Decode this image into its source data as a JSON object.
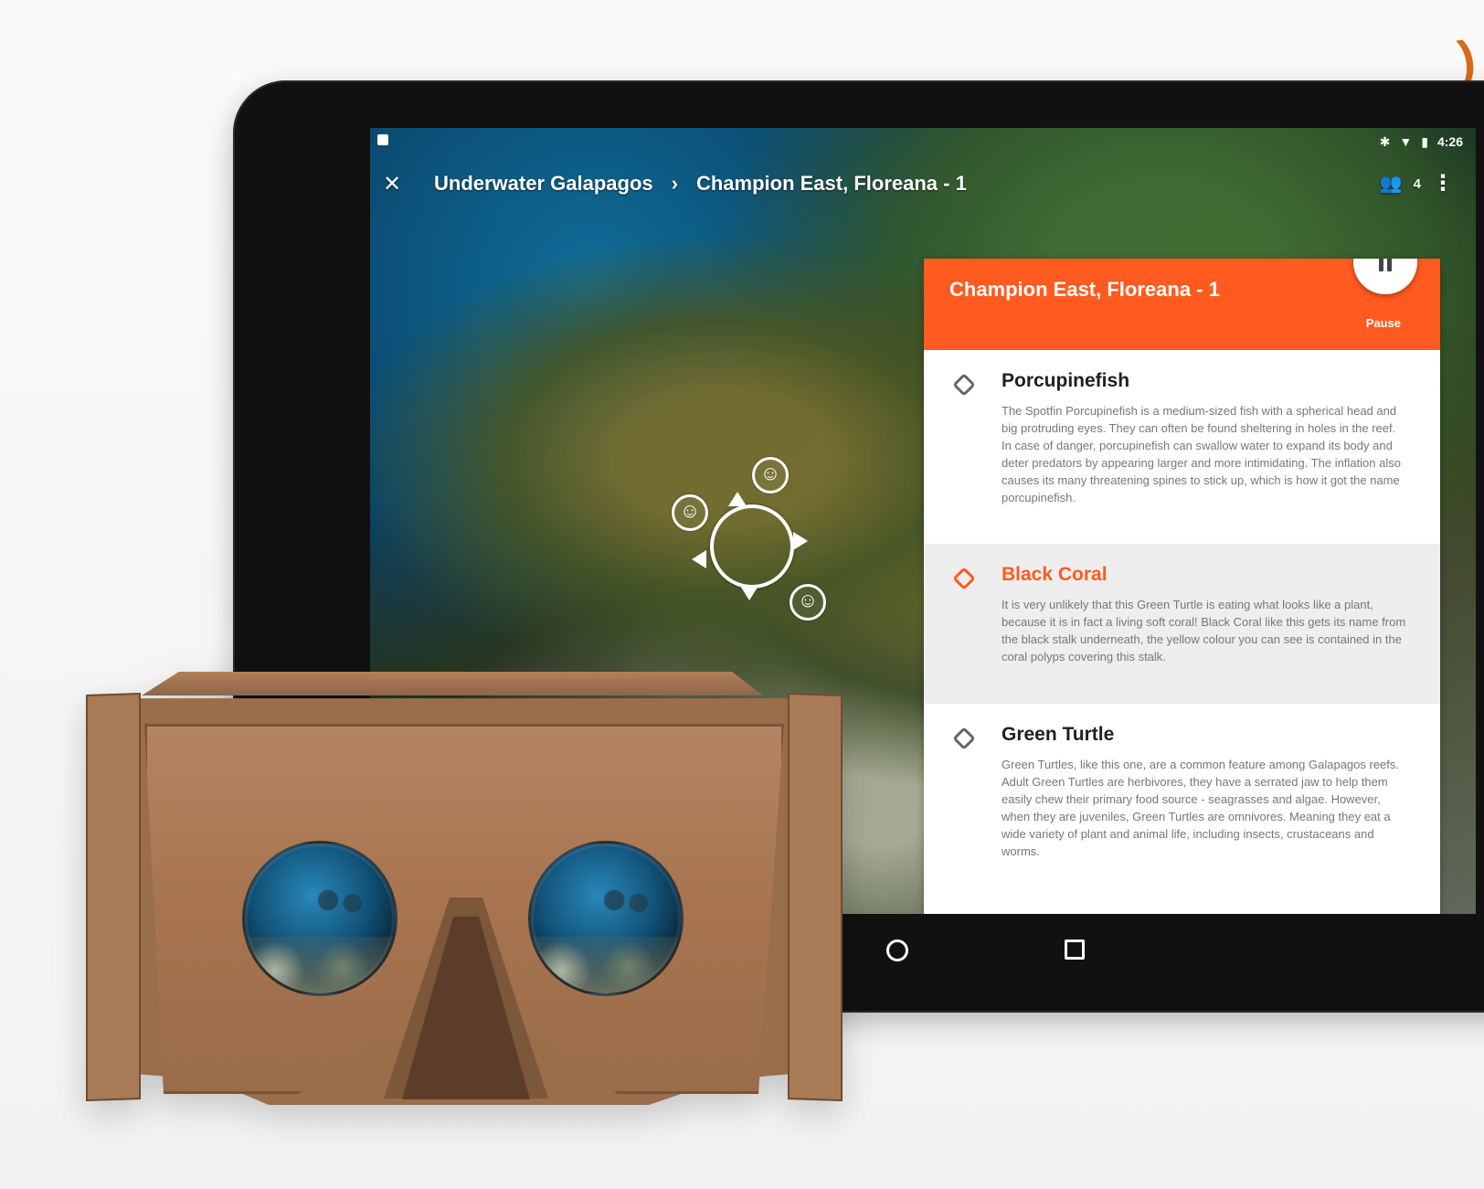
{
  "status_bar": {
    "time": "4:26",
    "icons": [
      "bluetooth-icon",
      "wifi-icon",
      "battery-icon"
    ]
  },
  "app_bar": {
    "close_icon": "close-icon",
    "breadcrumb": {
      "level1": "Underwater Galapagos",
      "separator": "›",
      "level2": "Champion East, Floreana - 1"
    },
    "participants_count": "4",
    "participants_icon": "people-icon",
    "more_icon": "more-vertical-icon"
  },
  "panel": {
    "title": "Champion East, Floreana - 1",
    "pause_label": "Pause",
    "items": [
      {
        "title": "Porcupinefish",
        "text": "The Spotfin Porcupinefish is a medium-sized fish with a spherical head and big protruding eyes. They can often be found sheltering in holes in the reef. In case of danger, porcupinefish can swallow water to expand its body and deter predators by appearing larger and more intimidating. The inflation also causes its many threatening spines to stick up, which is how it got the name porcupinefish."
      },
      {
        "title": "Black Coral",
        "text": "It is very unlikely that this Green Turtle is eating what looks like a plant, because it is in fact a living soft coral! Black Coral like this gets its name from the black stalk underneath, the yellow colour you can see is contained in the coral polyps covering this stalk."
      },
      {
        "title": "Green Turtle",
        "text": "Green Turtles, like this one, are a common feature among Galapagos reefs. Adult Green Turtles are herbivores, they have a serrated jaw to help them easily chew their primary food source - seagrasses and algae. However, when they are juveniles, Green Turtles are omnivores. Meaning they eat a wide variety of plant and animal life, including insects, crustaceans and worms."
      }
    ]
  },
  "navigation": {
    "home_icon": "home-circle-icon",
    "recents_icon": "recent-apps-icon"
  },
  "overlay": {
    "icons": [
      "reticle-icon",
      "smile-icon",
      "smile-icon",
      "smile-icon"
    ]
  },
  "colors": {
    "accent": "#ff5a1f",
    "background": "#f6f6f6",
    "device": "#111111"
  }
}
